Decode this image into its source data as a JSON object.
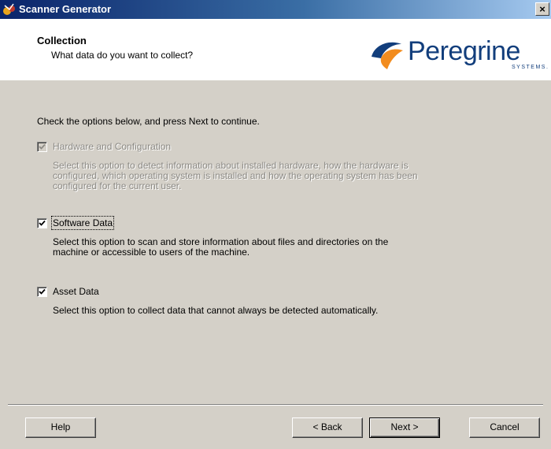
{
  "window": {
    "title": "Scanner Generator",
    "close_label": "×"
  },
  "header": {
    "title": "Collection",
    "subtitle": "What data do you want to collect?",
    "logo_text": "Peregrine",
    "logo_subtext": "SYSTEMS."
  },
  "body": {
    "instructions": "Check the options below, and press Next to continue.",
    "options": [
      {
        "label": "Hardware and Configuration",
        "checked": true,
        "enabled": false,
        "description": "Select this option to detect information about installed hardware, how the hardware is configured, which operating system is installed and how the operating system has been configured for the current user."
      },
      {
        "label": "Software Data",
        "checked": true,
        "enabled": true,
        "description": "Select this option to scan and store information about files and directories on the machine or accessible to users of the machine."
      },
      {
        "label": "Asset Data",
        "checked": true,
        "enabled": true,
        "description": "Select this option to collect data that cannot always be detected automatically."
      }
    ]
  },
  "footer": {
    "help_label": "Help",
    "back_label": "< Back",
    "next_label": "Next >",
    "cancel_label": "Cancel"
  },
  "colors": {
    "titlebar_start": "#0a246a",
    "titlebar_end": "#a6caf0",
    "dialog_bg": "#d4d0c8",
    "logo_blue": "#123e7c",
    "logo_orange": "#f28c1e"
  },
  "icons": {
    "title_icon": "scanner-generator-app-icon",
    "logo_icon": "peregrine-swoosh-icon",
    "check_icon": "checkmark-icon"
  }
}
